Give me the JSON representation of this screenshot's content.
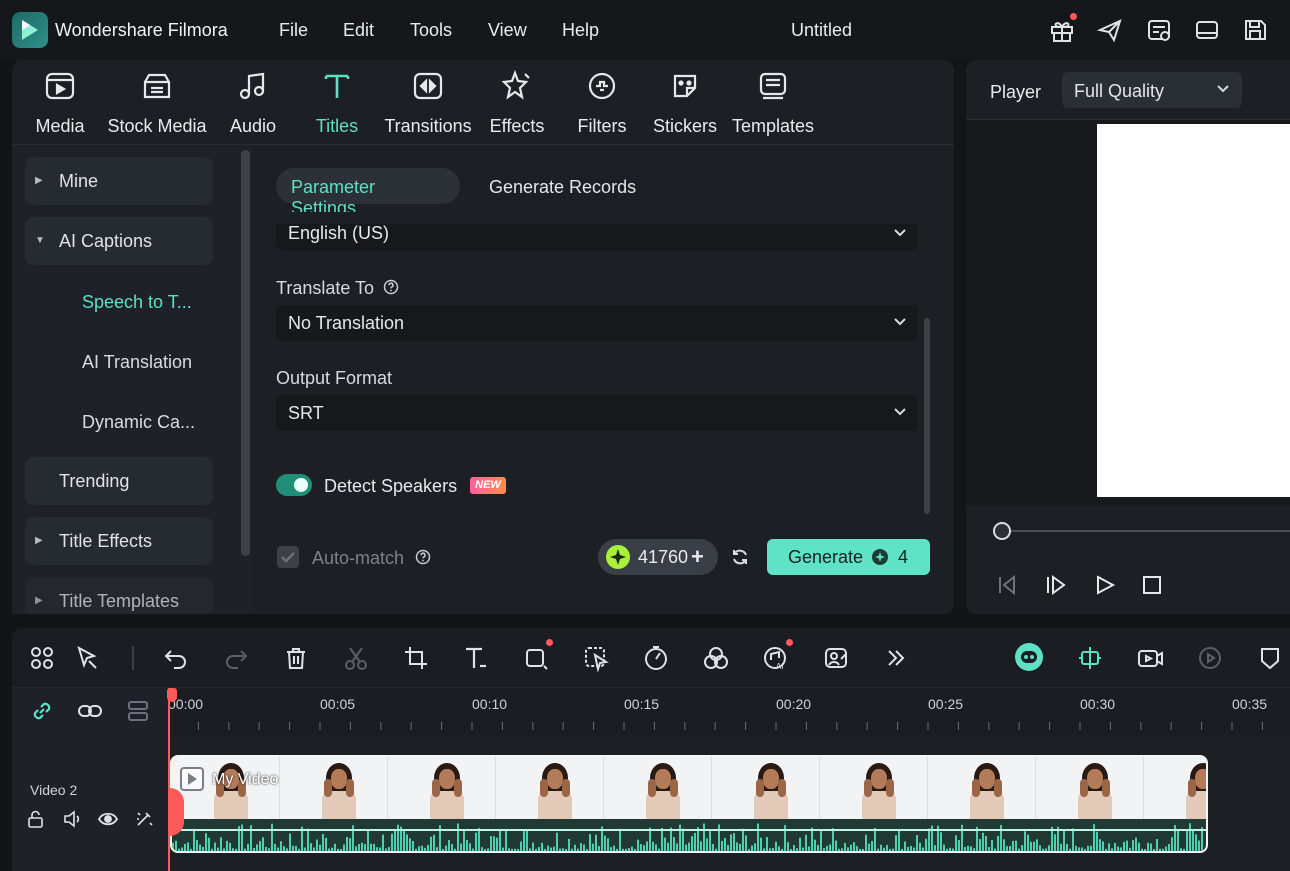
{
  "titlebar": {
    "app_name": "Wondershare Filmora",
    "menu": [
      "File",
      "Edit",
      "Tools",
      "View",
      "Help"
    ],
    "document_title": "Untitled",
    "right_icons": [
      "gift-icon",
      "send-icon",
      "task-list-icon",
      "layout-icon",
      "save-icon"
    ]
  },
  "library": {
    "tabs": [
      {
        "label": "Media",
        "icon": "media-icon"
      },
      {
        "label": "Stock Media",
        "icon": "stock-media-icon"
      },
      {
        "label": "Audio",
        "icon": "music-note-icon"
      },
      {
        "label": "Titles",
        "icon": "titles-icon",
        "active": true
      },
      {
        "label": "Transitions",
        "icon": "transitions-icon"
      },
      {
        "label": "Effects",
        "icon": "effects-icon"
      },
      {
        "label": "Filters",
        "icon": "filters-icon"
      },
      {
        "label": "Stickers",
        "icon": "stickers-icon"
      },
      {
        "label": "Templates",
        "icon": "templates-icon"
      }
    ]
  },
  "sidebar": {
    "mine": "Mine",
    "ai_captions": "AI Captions",
    "sub_items": [
      "Speech to T...",
      "AI Translation",
      "Dynamic Ca..."
    ],
    "trending": "Trending",
    "title_effects": "Title Effects",
    "title_templates": "Title Templates"
  },
  "content": {
    "tabs": [
      "Parameter Settings",
      "Generate Records"
    ],
    "language_value": "English (US)",
    "translate_label": "Translate To",
    "translate_value": "No Translation",
    "output_label": "Output Format",
    "output_value": "SRT",
    "detect_speakers_label": "Detect Speakers",
    "detect_speakers_on": true,
    "new_badge": "NEW",
    "auto_match_label": "Auto-match",
    "credits_value": "41760",
    "generate_label": "Generate",
    "generate_cost": "4"
  },
  "player": {
    "label": "Player",
    "quality": "Full Quality"
  },
  "timeline": {
    "ruler_labels": [
      "00:00",
      "00:05",
      "00:10",
      "00:15",
      "00:20",
      "00:25",
      "00:30",
      "00:35"
    ],
    "track_name": "Video 2",
    "clip_title": "My Video"
  },
  "colors": {
    "accent": "#5ee0c4",
    "playhead": "#ff5a5a",
    "panel": "#1c1f24"
  }
}
